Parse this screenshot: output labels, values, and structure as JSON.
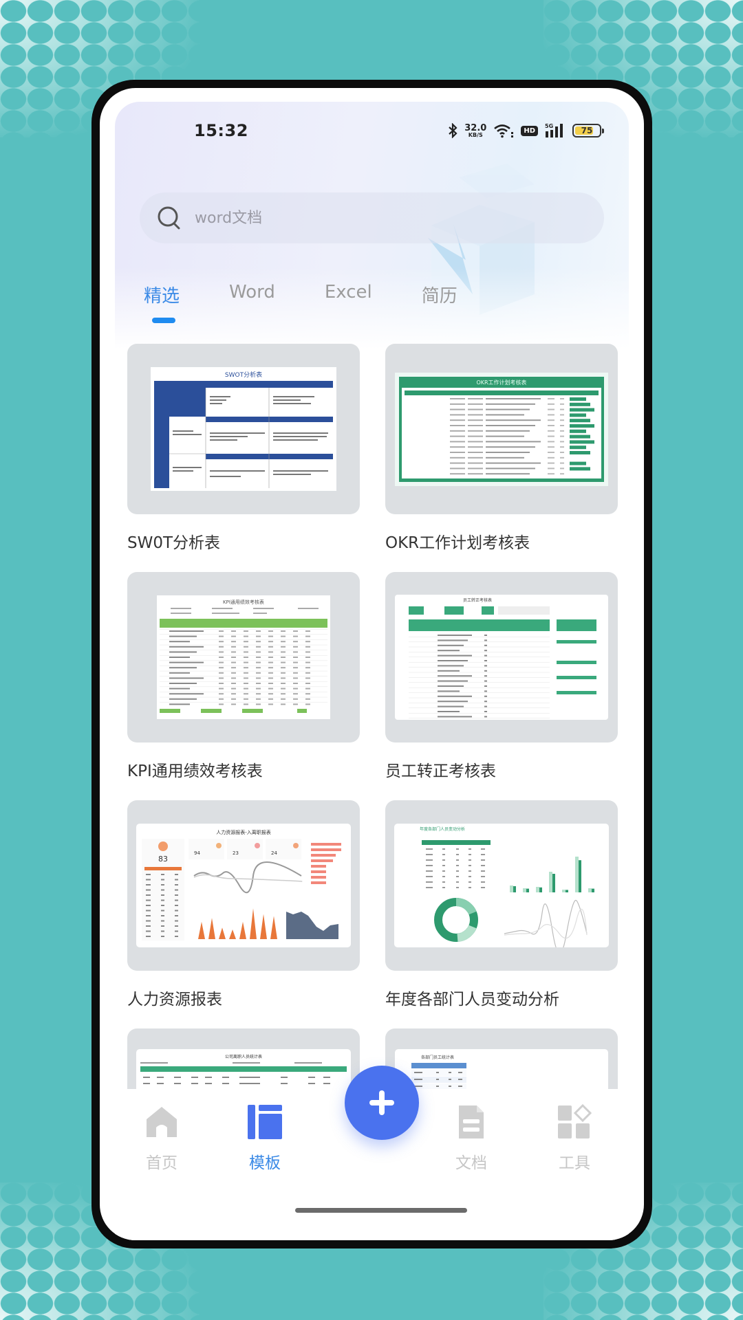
{
  "status_bar": {
    "time": "15:32",
    "net_speed_value": "32.0",
    "net_speed_unit": "KB/S",
    "hd_label": "HD",
    "network_type": "5G",
    "battery_level": "75",
    "battery_fraction": 0.75,
    "icons": [
      "bluetooth-icon",
      "wifi-icon",
      "hd-icon",
      "signal-icon",
      "battery-icon"
    ]
  },
  "search": {
    "placeholder": "word文档",
    "value": "",
    "icon": "search-icon"
  },
  "tabs": [
    {
      "label": "精选",
      "active": true
    },
    {
      "label": "Word",
      "active": false
    },
    {
      "label": "Excel",
      "active": false
    },
    {
      "label": "简历",
      "active": false
    }
  ],
  "templates": [
    {
      "title": "SW0T分析表",
      "preview_title": "SWOT分析表",
      "accent": "#2b4f9a"
    },
    {
      "title": "OKR工作计划考核表",
      "preview_title": "OKR工作计划考核表",
      "accent": "#2e9a6e"
    },
    {
      "title": "KPI通用绩效考核表",
      "preview_title": "KPI通用绩效考核表",
      "accent": "#7cc15a"
    },
    {
      "title": "员工转正考核表",
      "preview_title": "员工转正考核表",
      "accent": "#3aa97c"
    },
    {
      "title": "人力资源报表",
      "preview_title": "人力资源报表-入离职报表",
      "accent": "#e8773a"
    },
    {
      "title": "年度各部门人员变动分析",
      "preview_title": "年度各部门人员变动分析",
      "accent": "#2e9a6e"
    },
    {
      "title": "",
      "preview_title": "公司离职人员统计表",
      "accent": "#3aa97c"
    },
    {
      "title": "",
      "preview_title": "各部门员工统计表",
      "accent": "#3d8fe0"
    }
  ],
  "bottom_nav": {
    "items": [
      {
        "label": "首页",
        "icon": "home-icon",
        "active": false
      },
      {
        "label": "模板",
        "icon": "template-icon",
        "active": true
      },
      {
        "label": "文档",
        "icon": "document-icon",
        "active": false
      },
      {
        "label": "工具",
        "icon": "tools-icon",
        "active": false
      }
    ],
    "fab_icon": "plus-icon"
  },
  "colors": {
    "accent_blue": "#3b8ae6",
    "fab_blue": "#4a72ee",
    "background_teal": "#58bfbf",
    "inactive_gray": "#c6c6c6"
  }
}
